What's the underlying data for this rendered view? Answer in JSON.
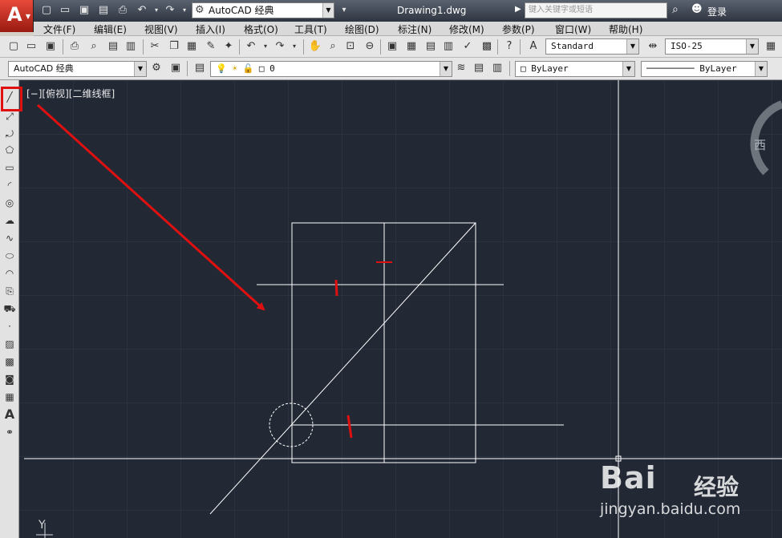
{
  "titlebar": {
    "workspace": "AutoCAD 经典",
    "document": "Drawing1.dwg",
    "search_placeholder": "键入关键字或短语",
    "login": "登录"
  },
  "menu": [
    "文件(F)",
    "编辑(E)",
    "视图(V)",
    "插入(I)",
    "格式(O)",
    "工具(T)",
    "绘图(D)",
    "标注(N)",
    "修改(M)",
    "参数(P)",
    "窗口(W)",
    "帮助(H)"
  ],
  "toolbar1": {
    "text_style": "Standard",
    "dim_style": "ISO-25"
  },
  "toolbar2": {
    "workspace": "AutoCAD 经典",
    "layer": "0",
    "color": "ByLayer",
    "linetype": "ByLayer"
  },
  "viewport": {
    "label": "[−][俯视][二维线框]"
  },
  "viewcube": {
    "west": "西"
  },
  "ucs": {
    "y_axis": "Y"
  },
  "watermark": {
    "logo": "Bai",
    "logo_suffix": "经验",
    "url": "jingyan.baidu.com"
  },
  "colors": {
    "canvas_bg": "#222834",
    "highlight_red": "#e01010",
    "lines": "#ffffff"
  }
}
